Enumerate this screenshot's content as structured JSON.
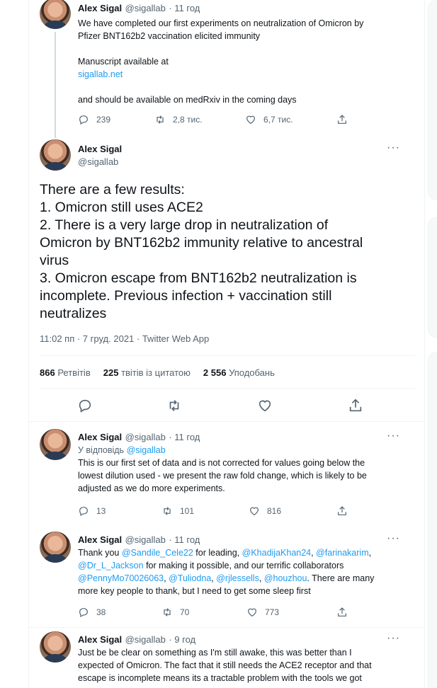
{
  "tweets": {
    "t1": {
      "name": "Alex Sigal",
      "handle": "@sigallab",
      "time": "· 11 год",
      "line1": "We have completed our first experiments on neutralization of Omicron by",
      "line2": "Pfizer BNT162b2 vaccination elicited immunity",
      "line3": "Manuscript available at",
      "link": "sigallab.net",
      "line4": "and should be available on medRxiv in the coming days",
      "replies": "239",
      "retweets": "2,8 тис.",
      "likes": "6,7 тис."
    },
    "main": {
      "name": "Alex Sigal",
      "handle": "@sigallab",
      "lines": [
        "There are a few results:",
        "1. Omicron still uses ACE2",
        "2. There is a very large drop in neutralization of",
        "Omicron by BNT162b2 immunity relative to ancestral",
        "virus",
        "3. Omicron escape from BNT162b2 neutralization is",
        "incomplete. Previous infection + vaccination still",
        "neutralizes"
      ],
      "meta": "11:02 пп · 7 груд. 2021 · Twitter Web App",
      "retweets_count": "866",
      "retweets_label": "Ретвітів",
      "quotes_count": "225",
      "quotes_label": "твітів із цитатою",
      "likes_count": "2 556",
      "likes_label": "Уподобань"
    },
    "r1": {
      "name": "Alex Sigal",
      "handle": "@sigallab",
      "time": "· 11 год",
      "reply_to_label": "У відповідь",
      "reply_to_handle": "@sigallab",
      "line1": "This is our first set of data and is not corrected for values going below the",
      "line2": "lowest dilution used - we present the raw fold change, which is likely to be",
      "line3": "adjusted as we do more experiments.",
      "replies": "13",
      "retweets": "101",
      "likes": "816"
    },
    "r2": {
      "name": "Alex Sigal",
      "handle": "@sigallab",
      "time": "· 11 год",
      "thank": "Thank you",
      "m1": "@Sandile_Cele22",
      "t1": "for leading,",
      "m2": "@KhadijaKhan24",
      "m3": "@farinakarim",
      "m4": "@Dr_L_Jackson",
      "t2": "for making it possible, and our terrific collaborators",
      "m5": "@PennyMo70026063",
      "m6": "@Tuliodna",
      "m7": "@rjlessells",
      "m8": "@houzhou",
      "t3": ". There are many",
      "t4": "more key people to thank, but I need to get some sleep first",
      "replies": "38",
      "retweets": "70",
      "likes": "773"
    },
    "r3": {
      "name": "Alex Sigal",
      "handle": "@sigallab",
      "time": "· 9 год",
      "line1": "Just be be clear on something as I'm still awake, this was better than I",
      "line2": "expected of Omicron. The fact that it still needs the ACE2 receptor and that",
      "line3": "escape is incomplete means its a tractable problem with the tools we got"
    }
  },
  "icons": {
    "more": "···"
  }
}
